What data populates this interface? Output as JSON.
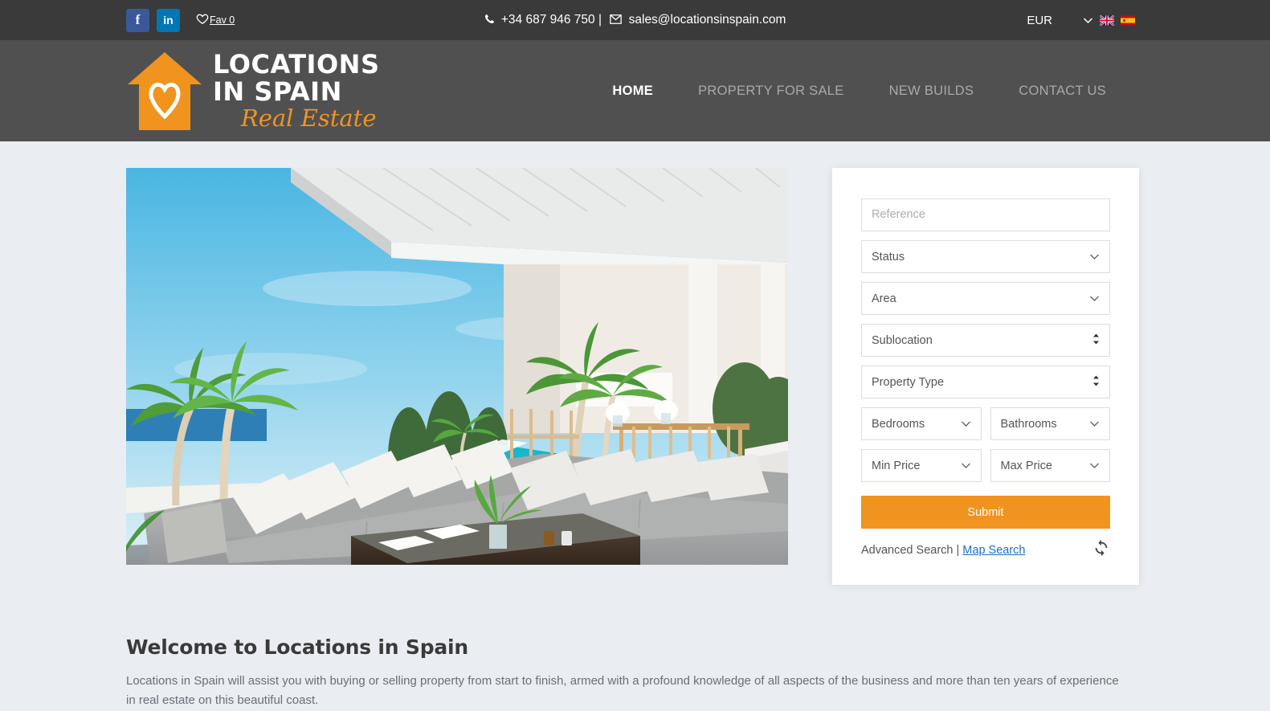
{
  "topbar": {
    "social": [
      {
        "name": "facebook",
        "glyph": "f",
        "color": "#3b5998"
      },
      {
        "name": "linkedin",
        "glyph": "in",
        "color": "#0077b5"
      }
    ],
    "fav_label": "Fav 0",
    "phone": "+34 687 946 750",
    "separator": "|",
    "email": "sales@locationsinspain.com",
    "currency": "EUR",
    "languages": [
      "en",
      "es"
    ]
  },
  "header": {
    "logo": {
      "line1": "LOCATIONS",
      "line2": "IN SPAIN",
      "line3": "Real Estate",
      "house_color": "#f0941f"
    },
    "nav": [
      {
        "label": "HOME",
        "active": true
      },
      {
        "label": "PROPERTY FOR SALE",
        "active": false
      },
      {
        "label": "NEW BUILDS",
        "active": false
      },
      {
        "label": "CONTACT US",
        "active": false
      }
    ]
  },
  "search": {
    "reference_placeholder": "Reference",
    "status_label": "Status",
    "area_label": "Area",
    "sublocation_label": "Sublocation",
    "property_type_label": "Property Type",
    "bedrooms_label": "Bedrooms",
    "bathrooms_label": "Bathrooms",
    "min_price_label": "Min Price",
    "max_price_label": "Max Price",
    "submit_label": "Submit",
    "advanced_search_label": "Advanced Search",
    "links_separator": " | ",
    "map_search_label": "Map Search",
    "accent_color": "#f0941f",
    "link_color": "#1a6fc4"
  },
  "welcome": {
    "heading": "Welcome to Locations in Spain",
    "paragraph": "Locations in Spain will assist you with buying or selling property from start to finish, armed with a profound knowledge of all aspects of the business and more than ten years of experience in real estate on this beautiful coast."
  },
  "hero": {
    "alt": "Luxury villa terrace with swimming pool, grey sectional sofa and palm trees"
  },
  "theme": {
    "topbar_bg": "#3a3a3a",
    "header_bg": "#505050",
    "page_bg": "#eaedf2",
    "panel_bg": "#ffffff"
  }
}
